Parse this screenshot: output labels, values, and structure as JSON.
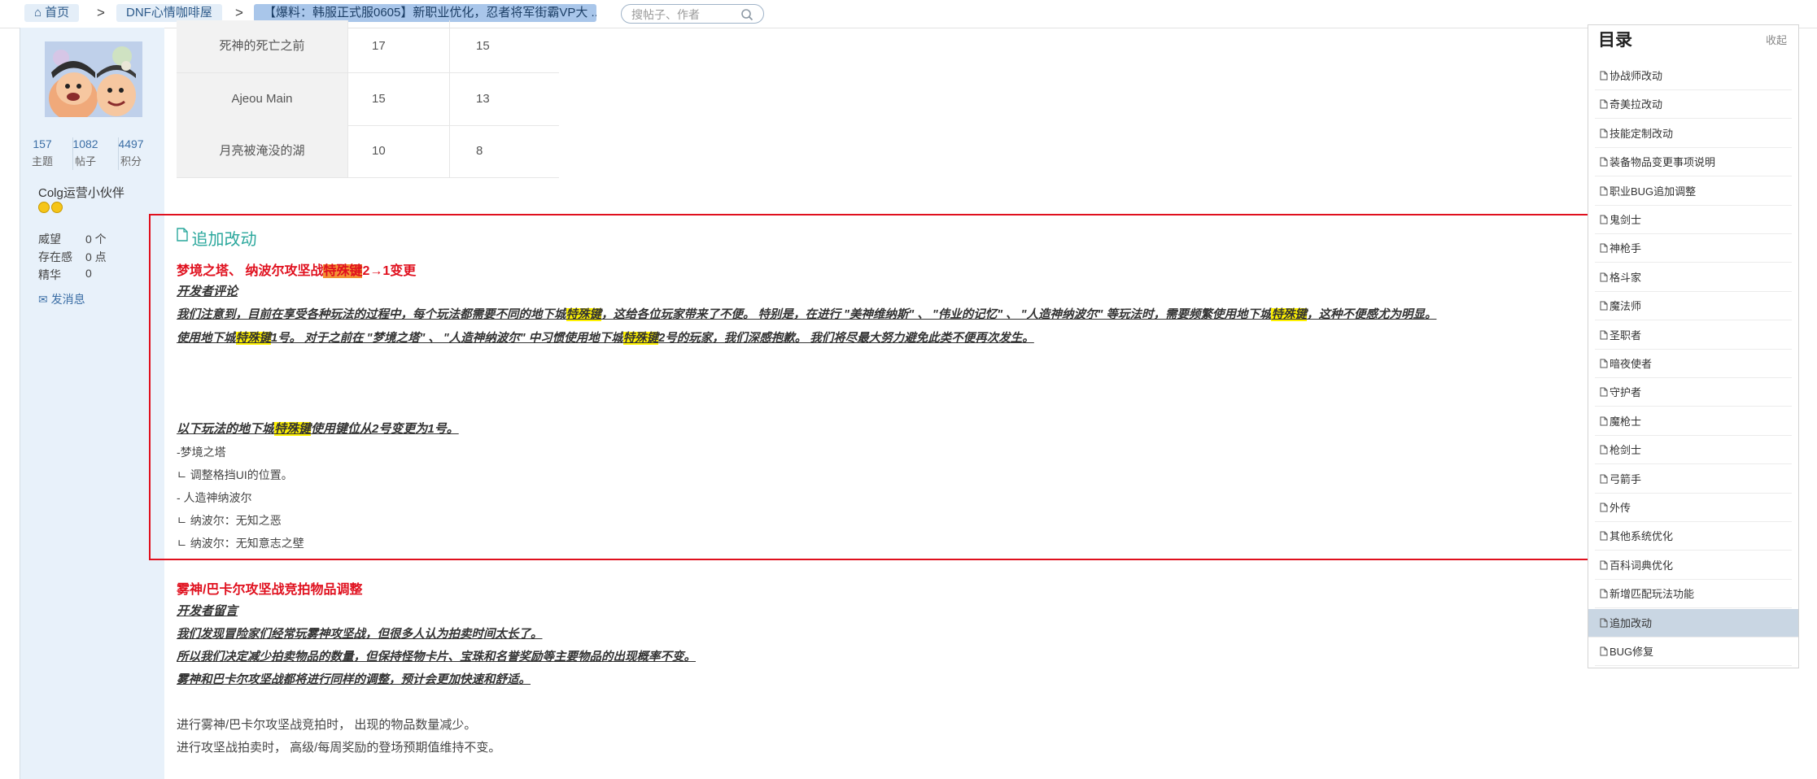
{
  "breadcrumb": {
    "home": "首页",
    "forum": "DNF心情咖啡屋",
    "thread": "【爆料：韩服正式服0605】新职业优化，忍者将军街霸VP大 ..."
  },
  "search": {
    "placeholder": "搜帖子、作者"
  },
  "author": {
    "stats": [
      {
        "num": "157",
        "label": "主题"
      },
      {
        "num": "1082",
        "label": "帖子"
      },
      {
        "num": "4497",
        "label": "积分"
      }
    ],
    "name": "Colg运营小伙伴",
    "attrs": [
      {
        "k": "威望",
        "v": "0 个"
      },
      {
        "k": "存在感",
        "v": "0 点"
      },
      {
        "k": "精华",
        "v": "0"
      }
    ],
    "message": "发消息"
  },
  "table_rows": [
    {
      "name": "死神的死亡之前",
      "a": "17",
      "b": "15"
    },
    {
      "name": "Ajeou Main",
      "a": "15",
      "b": "13"
    },
    {
      "name": "月亮被淹没的湖",
      "a": "10",
      "b": "8"
    }
  ],
  "section": {
    "heading": "追加改动",
    "t1": {
      "pre": "梦境之塔、 纳波尔攻坚战",
      "kw": "特殊键",
      "post": "2→1变更"
    },
    "dev_comment_label": "开发者评论",
    "para1_line1": {
      "a": "我们注意到，目前在享受各种玩法的过程中，每个玩法都需要不同的地下城",
      "kw1": "特殊键",
      "b": "，这给各位玩家带来了不便。 特别是，在进行 \"美神维纳斯\" 、 \"伟业的记忆\" 、 \"人造神纳波尔\" 等玩法时，需要频繁使用地下城",
      "kw2": "特殊键",
      "c": "，这种不便感尤为明显。"
    },
    "para1_line2": {
      "a": "使用地下城",
      "kw1": "特殊键",
      "b": "1号。 对于之前在 \"梦境之塔\" 、 \"人造神纳波尔\" 中习惯使用地下城",
      "kw2": "特殊键",
      "c": "2号的玩家，我们深感抱歉。 我们将尽最大努力避免此类不便再次发生。"
    },
    "para2": {
      "a": "以下玩法的地下城",
      "kw": "特殊键",
      "b": "使用键位从2号变更为1号。"
    },
    "list": [
      "-梦境之塔",
      "ㄴ 调整格挡UI的位置。",
      "- 人造神纳波尔",
      "ㄴ 纳波尔：无知之恶",
      "ㄴ 纳波尔：无知意志之壁"
    ]
  },
  "section2": {
    "title": "雾神/巴卡尔攻坚战竞拍物品调整",
    "dev_label": "开发者留言",
    "lines": [
      "我们发现冒险家们经常玩雾神攻坚战，但很多人认为拍卖时间太长了。",
      "所以我们决定减少拍卖物品的数量，但保持怪物卡片、宝珠和名誉奖励等主要物品的出现概率不变。",
      "雾神和巴卡尔攻坚战都将进行同样的调整，预计会更加快速和舒适。"
    ],
    "plain_lines": [
      "进行雾神/巴卡尔攻坚战竞拍时， 出现的物品数量减少。",
      "进行攻坚战拍卖时， 高级/每周奖励的登场预期值维持不变。"
    ]
  },
  "toc": {
    "title": "目录",
    "collapse": "收起",
    "items": [
      "协战师改动",
      "奇美拉改动",
      "技能定制改动",
      "装备物品变更事项说明",
      "职业BUG追加调整",
      "鬼剑士",
      "神枪手",
      "格斗家",
      "魔法师",
      "圣职者",
      "暗夜使者",
      "守护者",
      "魔枪士",
      "枪剑士",
      "弓箭手",
      "外传",
      "其他系统优化",
      "百科词典优化",
      "新增匹配玩法功能",
      "追加改动",
      "BUG修复"
    ],
    "active_index": 19
  },
  "colors": {
    "accent_red": "#e0101e",
    "teal_heading": "#2aa79c",
    "keyword_yellow": "#fff200",
    "keyword_orange": "#f29234",
    "left_panel_bg": "#e8f1fa",
    "toc_active_bg": "#c9d6e3"
  }
}
